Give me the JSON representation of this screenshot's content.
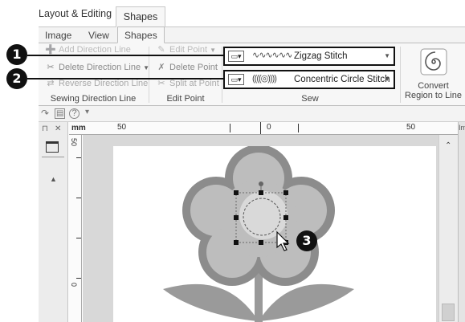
{
  "ribbon_tabs": {
    "context_group": "Layout & Editing",
    "context_tab": "Shapes",
    "tabs": [
      "Image",
      "View",
      "Shapes"
    ]
  },
  "ribbon": {
    "sewing_direction": {
      "add": "Add Direction Line",
      "delete": "Delete Direction Line",
      "reverse": "Reverse Direction Line",
      "label": "Sewing Direction Line"
    },
    "edit_point": {
      "edit": "Edit Point",
      "delete": "Delete Point",
      "split": "Split at Point",
      "label": "Edit Point"
    },
    "sew": {
      "line_stitch": "Zigzag Stitch",
      "region_stitch": "Concentric Circle Stitch",
      "label": "Sew"
    },
    "convert": {
      "line1": "Convert",
      "line2": "Region to Line"
    }
  },
  "quick_access": {
    "help": "?",
    "more": "▾"
  },
  "rulers": {
    "h_ticks": [
      "mm",
      "50",
      "0",
      "50",
      "Im"
    ],
    "v_ticks": [
      "50",
      "0"
    ]
  },
  "callouts": [
    "1",
    "2",
    "3"
  ],
  "colors": {
    "petals": "#8c8c8c",
    "petal_fill": "#bdbdbd",
    "center_fill": "#d9d9d9",
    "stem_leaves": "#9a9a9a",
    "badge": "#111111"
  },
  "icons": {
    "line_stitch_glyph": "∿∿∿∿∿∿",
    "region_stitch_glyph": "((((◎))))"
  }
}
